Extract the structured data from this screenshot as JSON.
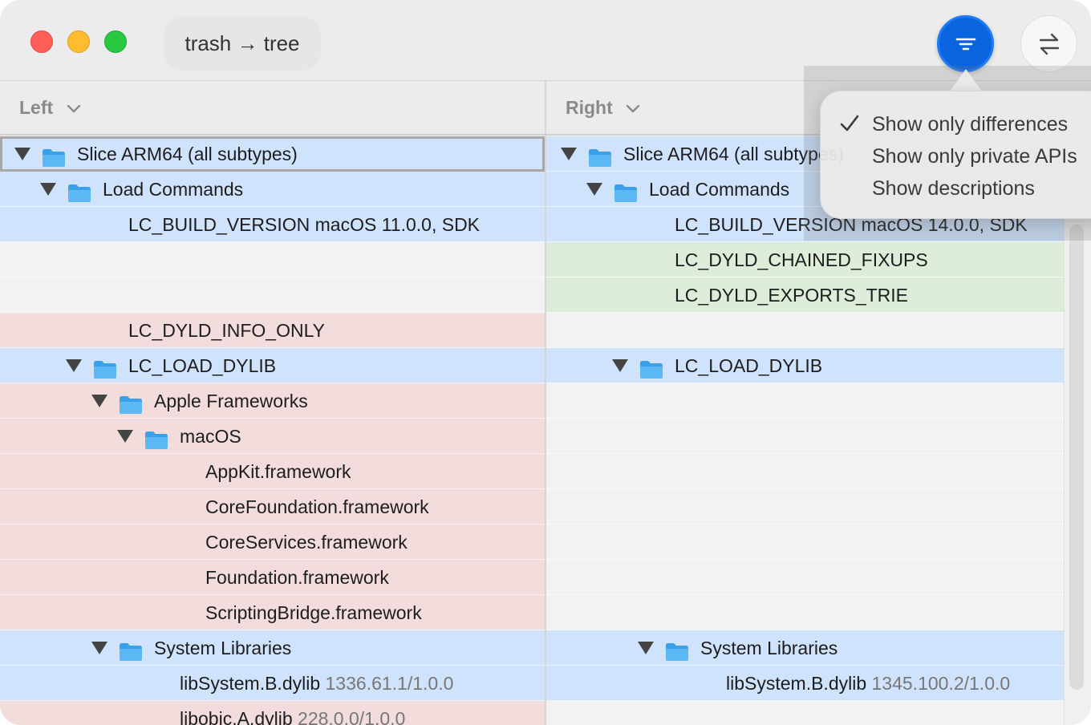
{
  "window": {
    "title": "trash → tree",
    "accent": "#0a64e0"
  },
  "columns": {
    "left_label": "Left",
    "right_label": "Right"
  },
  "toolbar": {
    "filter_icon": "filter-lines-icon",
    "swap_icon": "swap-arrows-icon"
  },
  "filter_menu": {
    "items": [
      {
        "label": "Show only differences",
        "checked": true
      },
      {
        "label": "Show only private APIs",
        "checked": false
      },
      {
        "label": "Show descriptions",
        "checked": false
      }
    ]
  },
  "left_rows": [
    {
      "text": "Slice ARM64 (all subtypes)",
      "version": "",
      "color": "blue",
      "indent": 0,
      "disclosure": true,
      "folder": true,
      "selected": true
    },
    {
      "text": "Load Commands",
      "version": "",
      "color": "blue",
      "indent": 1,
      "disclosure": true,
      "folder": true
    },
    {
      "text": "LC_BUILD_VERSION macOS 11.0.0, SDK",
      "version": "",
      "color": "blue",
      "indent": 2,
      "disclosure": false,
      "folder": false
    },
    {
      "text": "",
      "version": "",
      "color": "gray",
      "indent": 0
    },
    {
      "text": "",
      "version": "",
      "color": "gray",
      "indent": 0
    },
    {
      "text": "LC_DYLD_INFO_ONLY",
      "version": "",
      "color": "red",
      "indent": 2,
      "disclosure": false,
      "folder": false
    },
    {
      "text": "LC_LOAD_DYLIB",
      "version": "",
      "color": "blue",
      "indent": 2,
      "disclosure": true,
      "folder": true
    },
    {
      "text": "Apple Frameworks",
      "version": "",
      "color": "red",
      "indent": 3,
      "disclosure": true,
      "folder": true
    },
    {
      "text": "macOS",
      "version": "",
      "color": "red",
      "indent": 4,
      "disclosure": true,
      "folder": true
    },
    {
      "text": "AppKit.framework",
      "version": "",
      "color": "red",
      "indent": 5,
      "disclosure": false,
      "folder": false
    },
    {
      "text": "CoreFoundation.framework",
      "version": "",
      "color": "red",
      "indent": 5,
      "disclosure": false,
      "folder": false
    },
    {
      "text": "CoreServices.framework",
      "version": "",
      "color": "red",
      "indent": 5,
      "disclosure": false,
      "folder": false
    },
    {
      "text": "Foundation.framework",
      "version": "",
      "color": "red",
      "indent": 5,
      "disclosure": false,
      "folder": false
    },
    {
      "text": "ScriptingBridge.framework",
      "version": "",
      "color": "red",
      "indent": 5,
      "disclosure": false,
      "folder": false
    },
    {
      "text": "System Libraries",
      "version": "",
      "color": "blue",
      "indent": 3,
      "disclosure": true,
      "folder": true
    },
    {
      "text": "libSystem.B.dylib",
      "version": "1336.61.1/1.0.0",
      "color": "blue",
      "indent": 4,
      "disclosure": false,
      "folder": false
    },
    {
      "text": "libobjc.A.dylib",
      "version": "228.0.0/1.0.0",
      "color": "red",
      "indent": 4,
      "disclosure": false,
      "folder": false
    }
  ],
  "right_rows": [
    {
      "text": "Slice ARM64 (all subtypes)",
      "version": "",
      "color": "blue",
      "indent": 0,
      "disclosure": true,
      "folder": true
    },
    {
      "text": "Load Commands",
      "version": "",
      "color": "blue",
      "indent": 1,
      "disclosure": true,
      "folder": true
    },
    {
      "text": "LC_BUILD_VERSION macOS 14.0.0, SDK",
      "version": "",
      "color": "blue",
      "indent": 2,
      "disclosure": false,
      "folder": false
    },
    {
      "text": "LC_DYLD_CHAINED_FIXUPS",
      "version": "",
      "color": "green",
      "indent": 2,
      "disclosure": false,
      "folder": false
    },
    {
      "text": "LC_DYLD_EXPORTS_TRIE",
      "version": "",
      "color": "green",
      "indent": 2,
      "disclosure": false,
      "folder": false
    },
    {
      "text": "",
      "version": "",
      "color": "gray",
      "indent": 0
    },
    {
      "text": "LC_LOAD_DYLIB",
      "version": "",
      "color": "blue",
      "indent": 2,
      "disclosure": true,
      "folder": true
    },
    {
      "text": "",
      "version": "",
      "color": "gray",
      "indent": 0
    },
    {
      "text": "",
      "version": "",
      "color": "gray",
      "indent": 0
    },
    {
      "text": "",
      "version": "",
      "color": "gray",
      "indent": 0
    },
    {
      "text": "",
      "version": "",
      "color": "gray",
      "indent": 0
    },
    {
      "text": "",
      "version": "",
      "color": "gray",
      "indent": 0
    },
    {
      "text": "",
      "version": "",
      "color": "gray",
      "indent": 0
    },
    {
      "text": "",
      "version": "",
      "color": "gray",
      "indent": 0
    },
    {
      "text": "System Libraries",
      "version": "",
      "color": "blue",
      "indent": 3,
      "disclosure": true,
      "folder": true
    },
    {
      "text": "libSystem.B.dylib",
      "version": "1345.100.2/1.0.0",
      "color": "blue",
      "indent": 4,
      "disclosure": false,
      "folder": false
    },
    {
      "text": "",
      "version": "",
      "color": "gray",
      "indent": 0
    }
  ]
}
